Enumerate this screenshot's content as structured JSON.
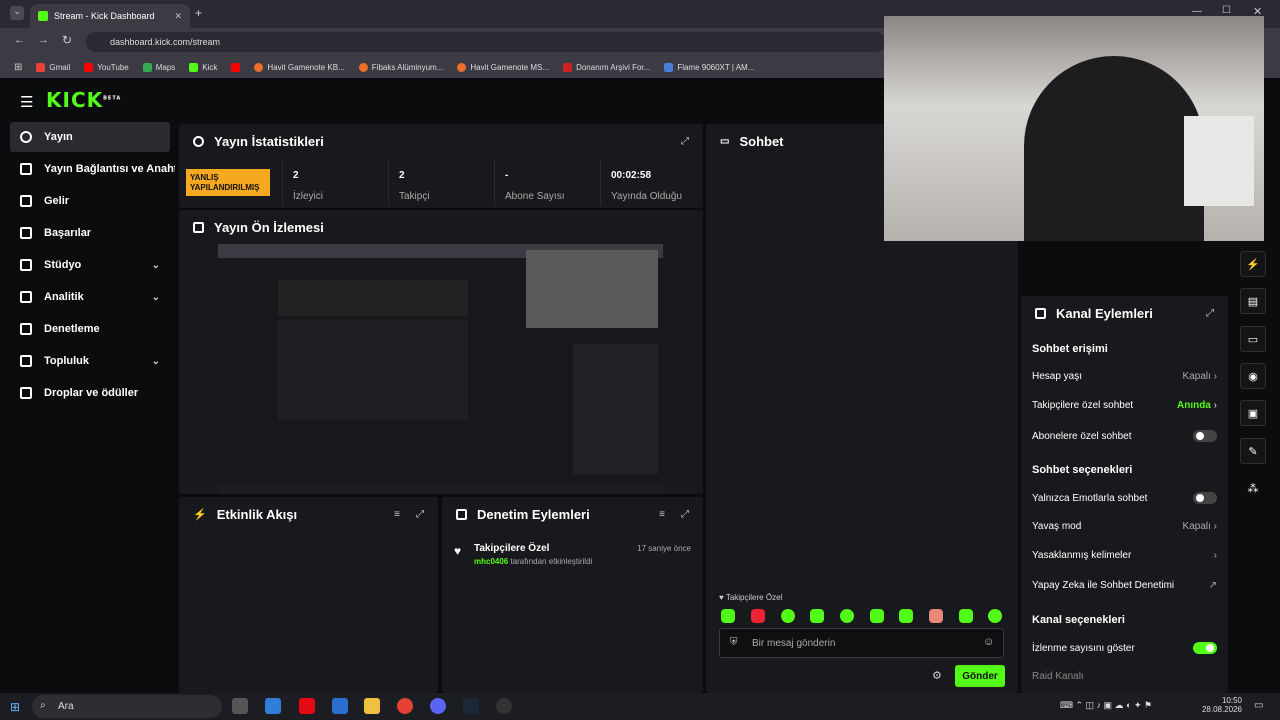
{
  "browser": {
    "tab_title": "Stream - Kick Dashboard",
    "url": "dashboard.kick.com/stream",
    "bookmarks": [
      "Gmail",
      "YouTube",
      "Maps",
      "Kick",
      "",
      "Havit Gamenote KB...",
      "Fibaks Alüminyum...",
      "Havit Gamenote MS...",
      "Donanım Arşivi For...",
      "Flame 9060XT | AM..."
    ]
  },
  "brand": {
    "logo": "KICK",
    "beta": "BETA",
    "accent": "#53fc18"
  },
  "sidebar": {
    "items": [
      {
        "label": "Yayın",
        "icon": "broadcast-icon",
        "active": true
      },
      {
        "label": "Yayın Bağlantısı ve Anahtarı",
        "icon": "link-icon"
      },
      {
        "label": "Gelir",
        "icon": "wallet-icon"
      },
      {
        "label": "Başarılar",
        "icon": "trophy-icon"
      },
      {
        "label": "Stüdyo",
        "icon": "studio-icon",
        "chevron": true
      },
      {
        "label": "Analitik",
        "icon": "analytics-icon",
        "chevron": true
      },
      {
        "label": "Denetleme",
        "icon": "wrench-icon"
      },
      {
        "label": "Topluluk",
        "icon": "community-icon",
        "chevron": true
      },
      {
        "label": "Droplar ve ödüller",
        "icon": "gift-icon"
      }
    ]
  },
  "stats": {
    "title": "Yayın İstatistikleri",
    "badge_line1": "YANLIŞ",
    "badge_line2": "YAPILANDIRILMIŞ",
    "items": [
      {
        "value": "2",
        "label": "İzleyici"
      },
      {
        "value": "2",
        "label": "Takipçi"
      },
      {
        "value": "-",
        "label": "Abone Sayısı"
      },
      {
        "value": "00:02:58",
        "label": "Yayında Olduğu"
      }
    ]
  },
  "preview": {
    "title": "Yayın Ön İzlemesi"
  },
  "activity": {
    "title": "Etkinlik Akışı"
  },
  "moderation": {
    "title": "Denetim Eylemleri",
    "entry_title": "Takipçilere Özel",
    "entry_time": "17 saniye önce",
    "entry_user": "mhc0406",
    "entry_text": " tarafından etkinleştirildi"
  },
  "chat": {
    "title": "Sohbet",
    "mode_label": "Takipçilere Özel",
    "input_placeholder": "Bir mesaj gönderin",
    "send_label": "Gönder"
  },
  "channel": {
    "title": "Kanal Eylemleri",
    "sec1": "Sohbet erişimi",
    "account_age": "Hesap yaşı",
    "account_age_val": "Kapalı",
    "followers_only": "Takipçilere özel sohbet",
    "followers_only_val": "Anında",
    "subs_only": "Abonelere özel sohbet",
    "sec2": "Sohbet seçenekleri",
    "emote_only": "Yalnızca Emotlarla sohbet",
    "slow_mode": "Yavaş mod",
    "slow_mode_val": "Kapalı",
    "banned_words": "Yasaklanmış kelimeler",
    "ai_mod": "Yapay Zeka ile Sohbet Denetimi",
    "sec3": "Kanal seçenekleri",
    "show_views": "İzlenme sayısını göster",
    "raid": "Raid Kanalı"
  },
  "taskbar": {
    "search": "Ara",
    "time": "10:50",
    "date": "28.08.2026"
  }
}
